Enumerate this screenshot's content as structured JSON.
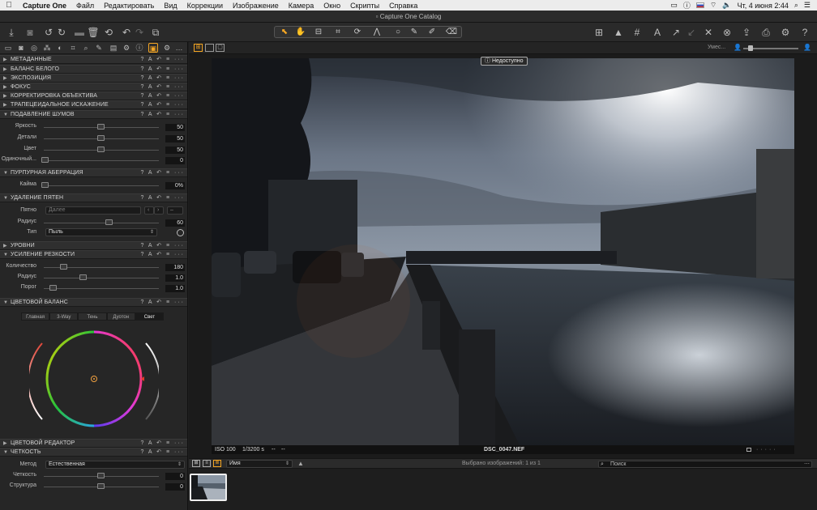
{
  "menubar": {
    "app_name": "Capture One",
    "items": [
      "Файл",
      "Редактировать",
      "Вид",
      "Коррекции",
      "Изображение",
      "Камера",
      "Окно",
      "Скрипты",
      "Справка"
    ],
    "clock": "Чт, 4 июня  2:44"
  },
  "window": {
    "title": "Capture One Catalog"
  },
  "viewer": {
    "unavailable_label": "Недоступно",
    "iso": "ISO 100",
    "shutter": "1/3200 s",
    "extra1": "--",
    "extra2": "--",
    "filename": "DSC_0047.NEF",
    "scale_label": "Умес..."
  },
  "browser": {
    "sort_value": "Имя",
    "status": "Выбрано изображений: 1 из 1",
    "search_placeholder": "Поиск"
  },
  "panel": {
    "sections": {
      "metadata": "МЕТАДАННЫЕ",
      "white_balance": "БАЛАНС БЕЛОГО",
      "exposure": "ЭКСПОЗИЦИЯ",
      "focus": "ФОКУС",
      "lens": "КОРРЕКТИРОВКА ОБЪЕКТИВА",
      "keystone": "ТРАПЕЦЕИДАЛЬНОЕ ИСКАЖЕНИЕ",
      "noise": "ПОДАВЛЕНИЕ ШУМОВ",
      "purple": "ПУРПУРНАЯ АБЕРРАЦИЯ",
      "spots": "УДАЛЕНИЕ ПЯТЕН",
      "levels": "УРОВНИ",
      "sharpening": "УСИЛЕНИЕ РЕЗКОСТИ",
      "color_balance": "ЦВЕТОВОЙ БАЛАНС",
      "color_editor": "ЦВЕТОВОЙ РЕДАКТОР",
      "clarity": "ЧЕТКОСТЬ"
    },
    "section_icons": "? A ↶ ≡ ···",
    "noise": [
      {
        "label": "Яркость",
        "value": "50"
      },
      {
        "label": "Детали",
        "value": "50"
      },
      {
        "label": "Цвет",
        "value": "50"
      },
      {
        "label": "Одиночный...",
        "value": "0"
      }
    ],
    "purple": {
      "label": "Кайма",
      "value": "0%"
    },
    "spots": {
      "spot_label": "Пятно",
      "spot_value": "Далее",
      "radius_label": "Радиус",
      "radius_value": "60",
      "type_label": "Тип",
      "type_value": "Пыль"
    },
    "sharpening": [
      {
        "label": "Количество",
        "value": "180"
      },
      {
        "label": "Радиус",
        "value": "1.0"
      },
      {
        "label": "Порог",
        "value": "1.0"
      }
    ],
    "color_balance_tabs": [
      "Главная",
      "3-Way",
      "Тень",
      "Дуотон",
      "Свет"
    ],
    "clarity": {
      "method_label": "Метод",
      "method_value": "Естественная",
      "clarity_label": "Четкость",
      "clarity_value": "0",
      "structure_label": "Структура",
      "structure_value": "0"
    }
  }
}
